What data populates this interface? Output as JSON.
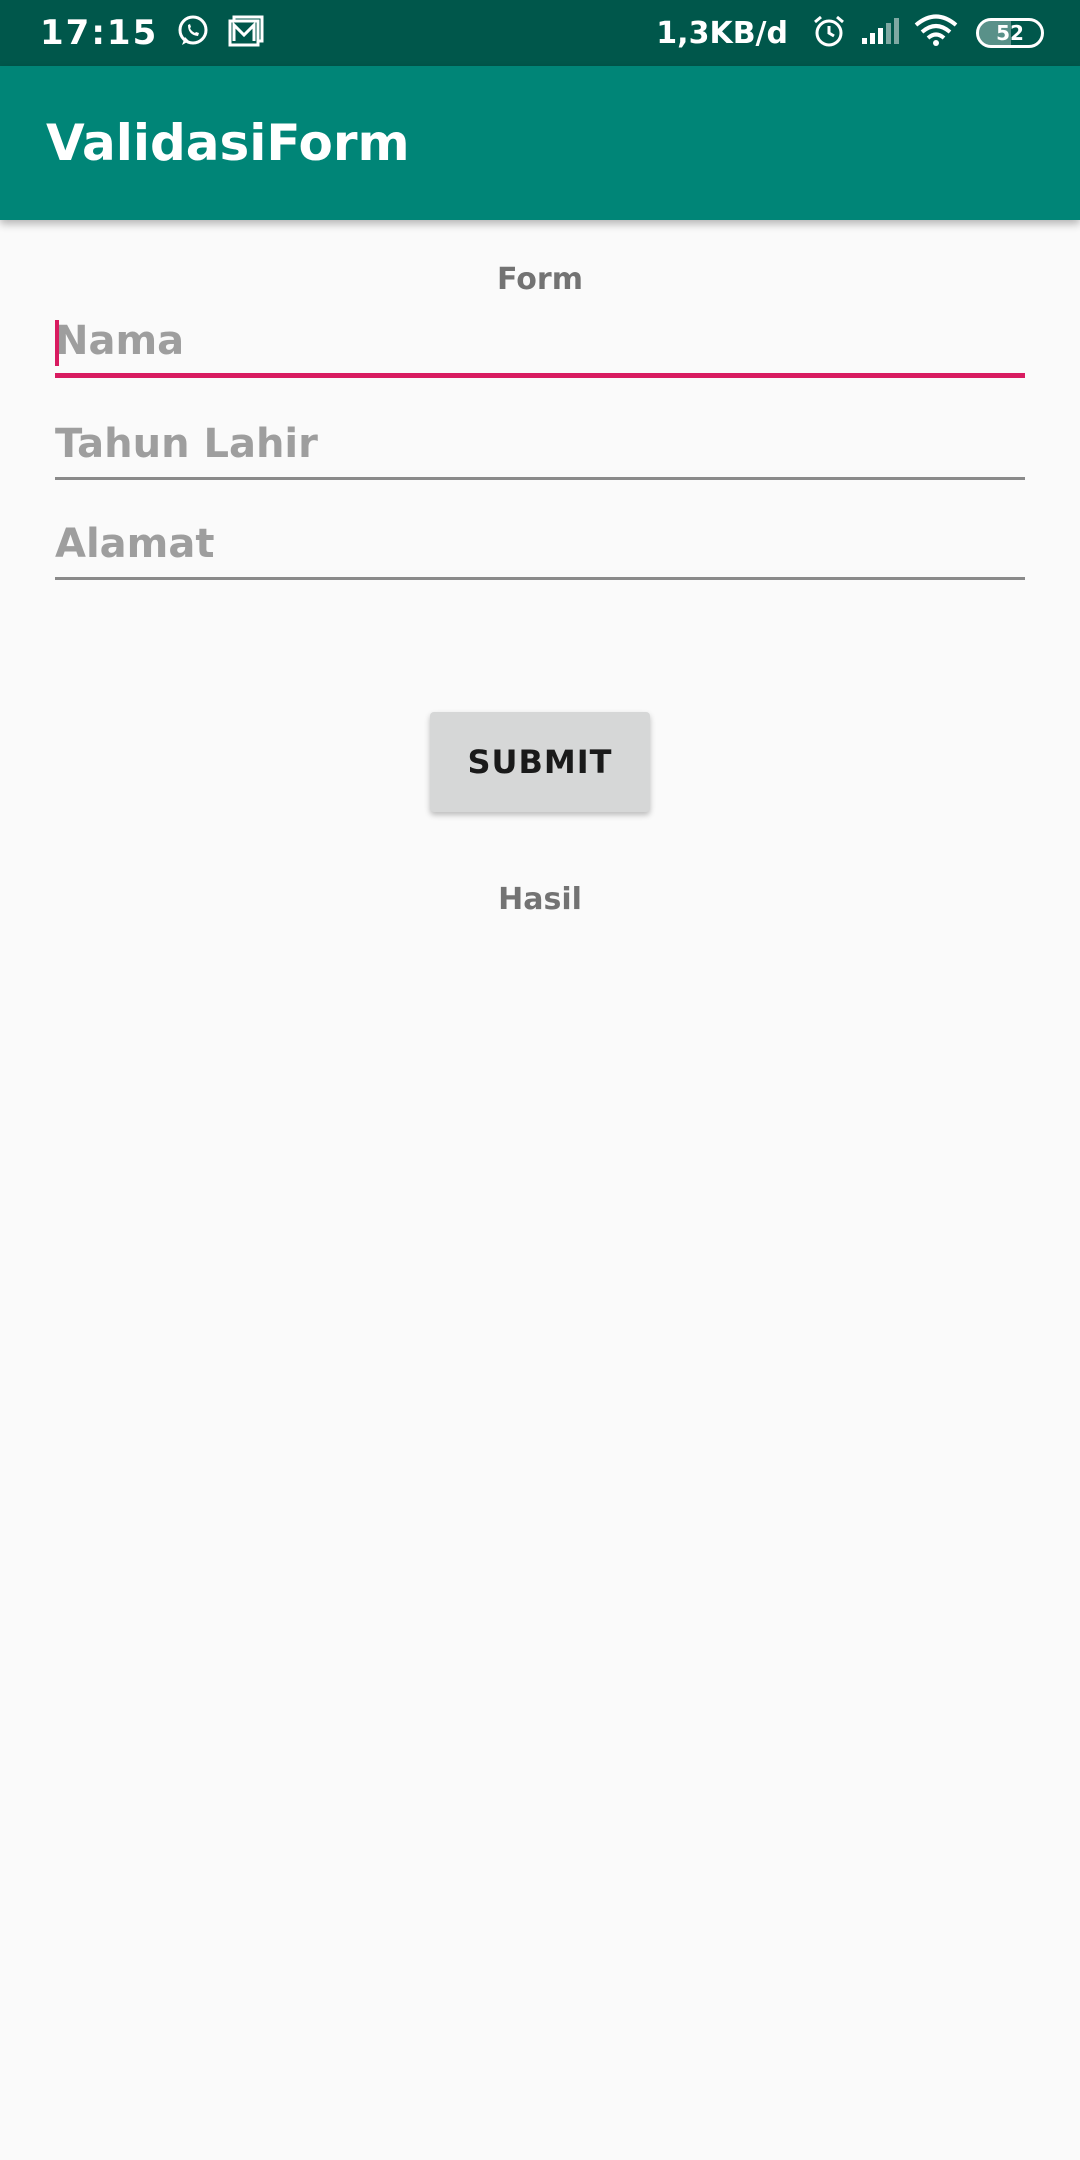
{
  "status_bar": {
    "time": "17:15",
    "network_speed": "1,3KB/d",
    "battery_level": "52",
    "icons": [
      "whatsapp-icon",
      "gallery-icon",
      "alarm-icon",
      "signal-icon",
      "wifi-icon",
      "battery-icon"
    ]
  },
  "app_bar": {
    "title": "ValidasiForm",
    "color": "#008577"
  },
  "form": {
    "heading": "Form",
    "fields": [
      {
        "placeholder": "Nama",
        "value": "",
        "focused": true
      },
      {
        "placeholder": "Tahun Lahir",
        "value": ""
      },
      {
        "placeholder": "Alamat",
        "value": ""
      }
    ],
    "submit_label": "SUBMIT",
    "result_label": "Hasil"
  },
  "colors": {
    "status_bar": "#00574B",
    "accent": "#D81B60",
    "background": "#FAFAFA"
  }
}
